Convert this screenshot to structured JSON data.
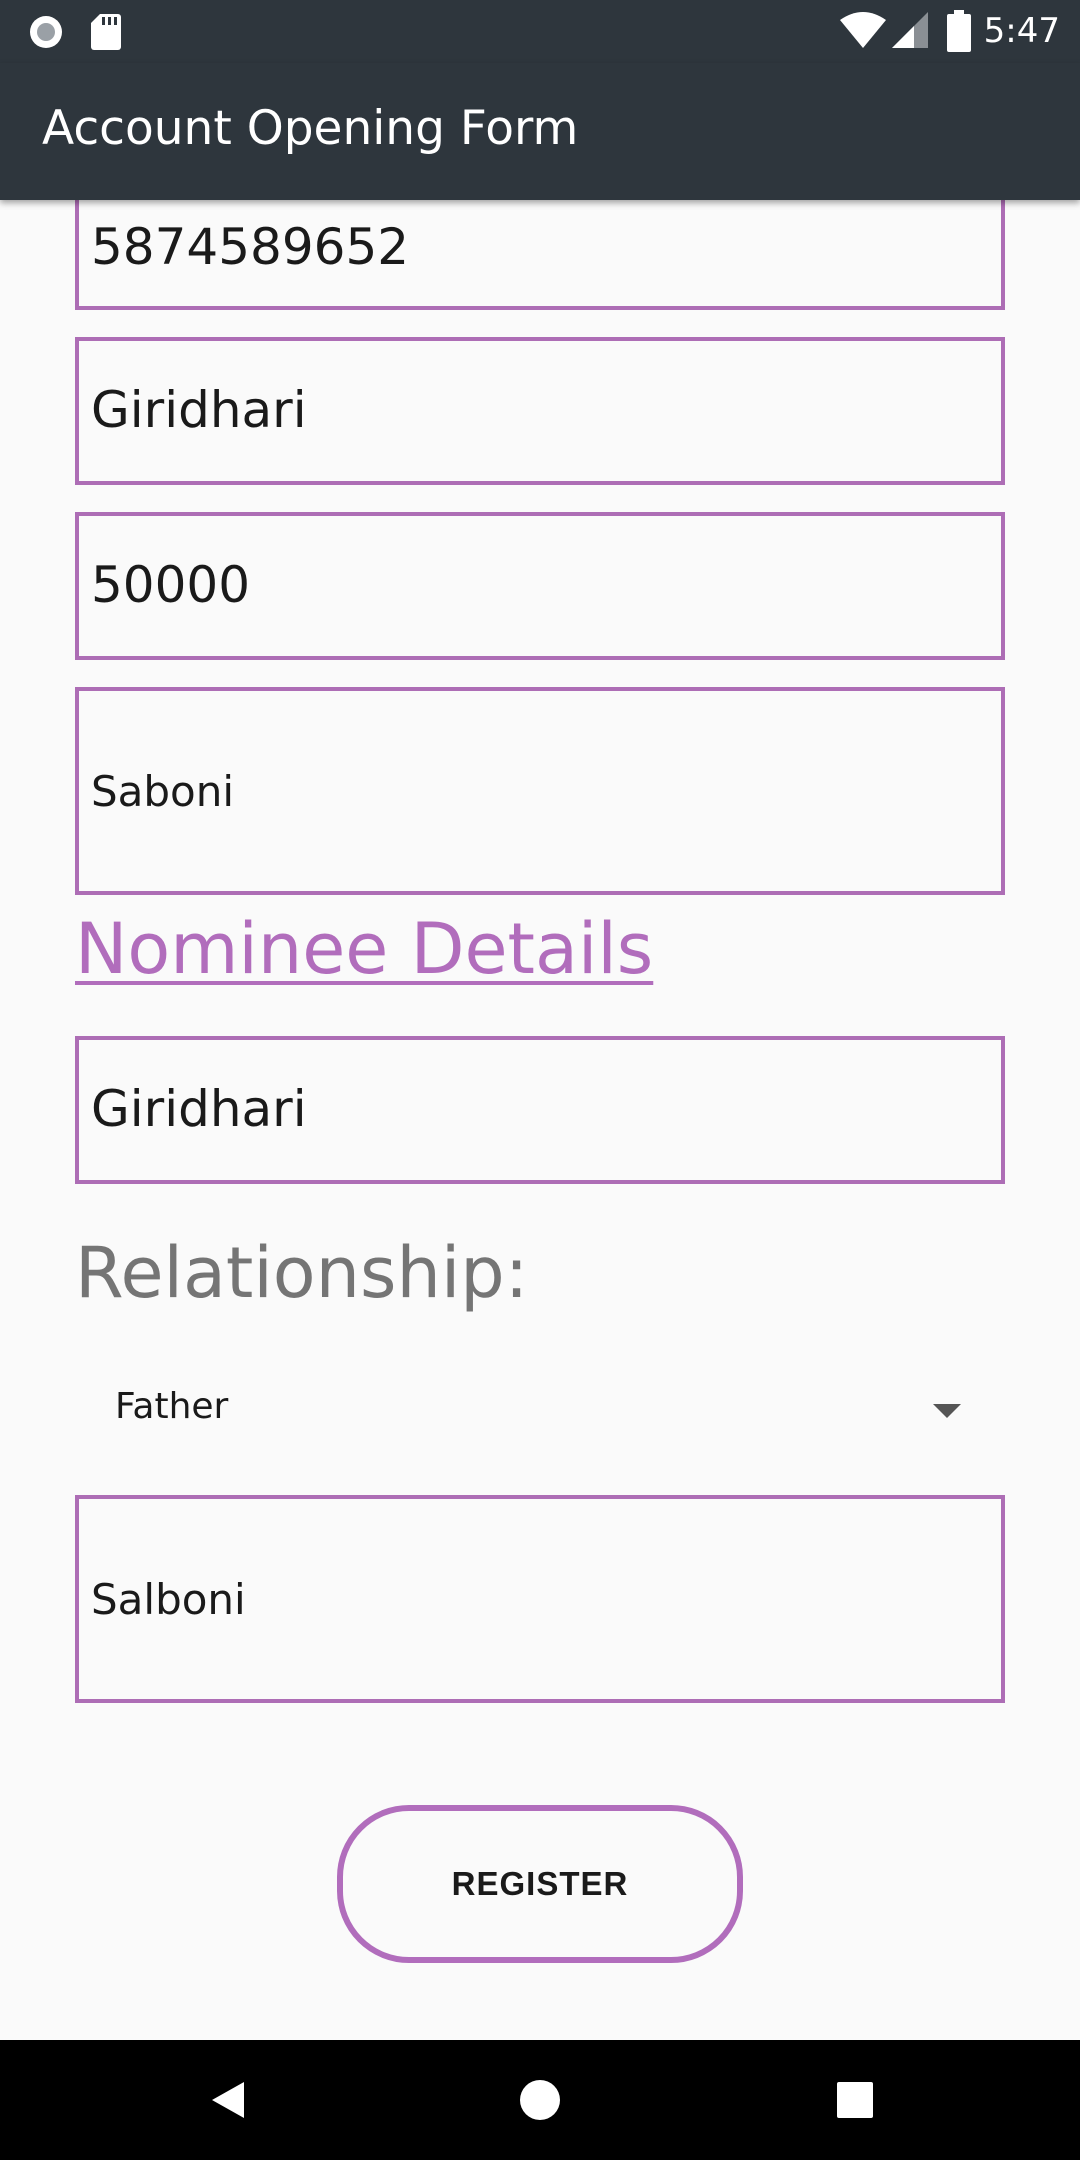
{
  "status_bar": {
    "time": "5:47",
    "icons": [
      "record-icon",
      "sd-card-icon",
      "wifi-icon",
      "signal-icon",
      "battery-icon"
    ]
  },
  "app_bar": {
    "title": "Account Opening Form"
  },
  "form": {
    "phone": "5874589652",
    "name": "Giridhari",
    "amount": "50000",
    "address": "Saboni",
    "nominee_section_title": "Nominee Details",
    "nominee_name": "Giridhari",
    "relationship_label": "Relationship:",
    "relationship_selected": "Father",
    "nominee_address": "Salboni",
    "register_label": "REGISTER"
  },
  "nav_bar": {
    "buttons": [
      "back-icon",
      "home-icon",
      "recents-icon"
    ]
  },
  "colors": {
    "accent": "#b16dbc",
    "bar": "#2e363d"
  }
}
